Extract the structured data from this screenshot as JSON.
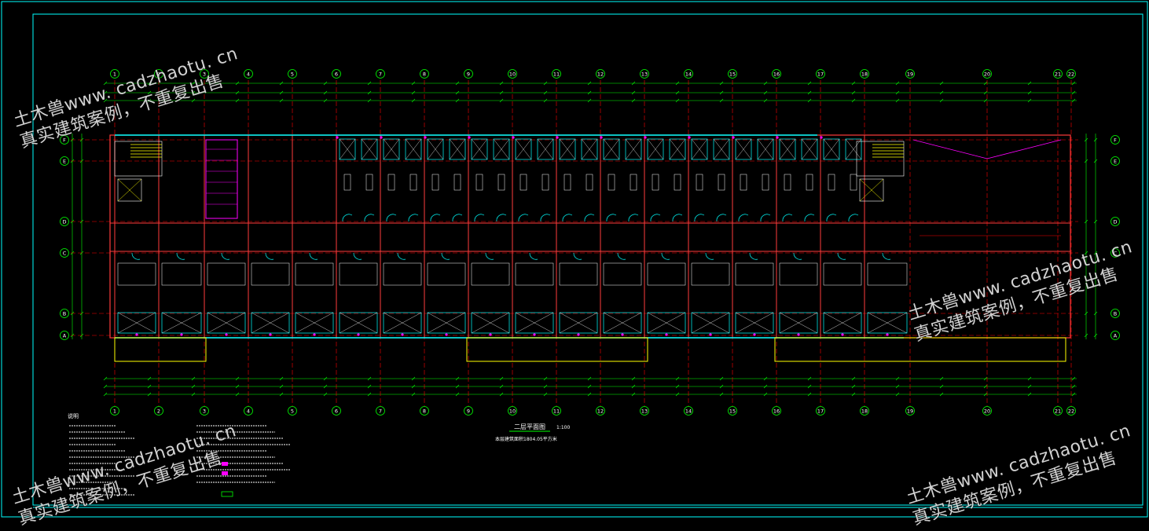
{
  "drawing": {
    "plan_title": "二层平面图",
    "plan_scale": "1:100",
    "plan_subtitle": "本层建筑面积1804.05平方米",
    "notes_title": "说明"
  },
  "grid": {
    "columns": [
      "1",
      "2",
      "3",
      "4",
      "5",
      "6",
      "7",
      "8",
      "9",
      "10",
      "11",
      "12",
      "13",
      "14",
      "15",
      "16",
      "17",
      "18",
      "19",
      "20",
      "21",
      "22"
    ],
    "rows": [
      "F",
      "E",
      "D",
      "C",
      "B",
      "A"
    ]
  },
  "watermark": {
    "line1": "土木兽www. cadzhaotu. cn",
    "line2": "真实建筑案例，不重复出售"
  },
  "colors": {
    "background": "#000000",
    "frame": "#00ffff",
    "grid_axis": "#ff0000",
    "wall": "#ff3b3b",
    "window": "#00ffff",
    "fixture": "#ffffff",
    "dimension": "#00ff00",
    "highlight": "#ff00ff",
    "balcony": "#ffff00"
  }
}
